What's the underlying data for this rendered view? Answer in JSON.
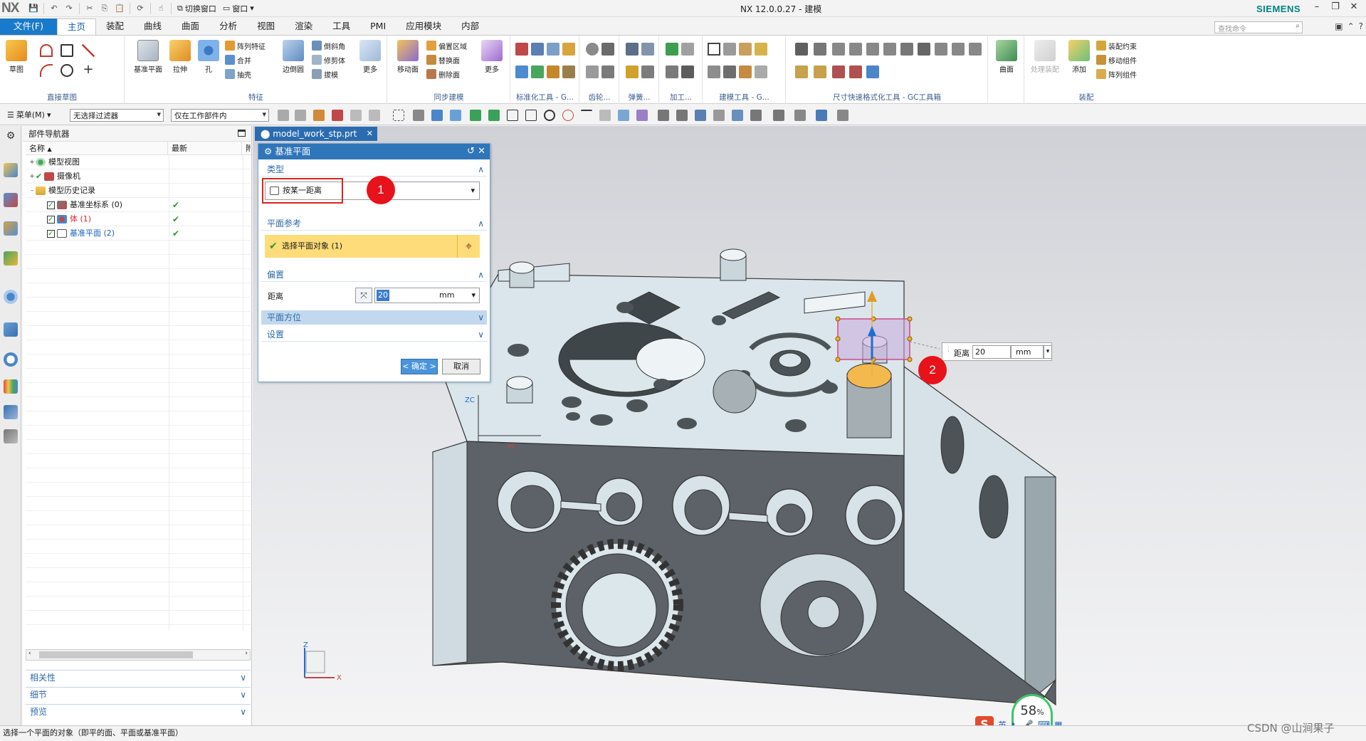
{
  "app": {
    "logo": "NX",
    "title": "NX 12.0.0.27 - 建模",
    "brand": "SIEMENS"
  },
  "quick_access": {
    "switch_window": "切换窗口",
    "window": "窗口"
  },
  "tabs": [
    {
      "label": "文件(F)"
    },
    {
      "label": "主页"
    },
    {
      "label": "装配"
    },
    {
      "label": "曲线"
    },
    {
      "label": "曲面"
    },
    {
      "label": "分析"
    },
    {
      "label": "视图"
    },
    {
      "label": "渲染"
    },
    {
      "label": "工具"
    },
    {
      "label": "PMI"
    },
    {
      "label": "应用模块"
    },
    {
      "label": "内部"
    }
  ],
  "command_search": {
    "placeholder": "查找命令"
  },
  "ribbon": {
    "groups": {
      "direct_sketch": "直接草图",
      "feature": "特征",
      "sync": "同步建模",
      "standard_tools": "标准化工具 - G...",
      "gear": "齿轮...",
      "spring": "弹簧...",
      "machining": "加工...",
      "modeling_tools": "建模工具 - G...",
      "dim_style": "尺寸快速格式化工具 - GC工具箱",
      "assembly": "装配"
    },
    "buttons": {
      "sketch": "草图",
      "datum_plane": "基准平面",
      "extrude": "拉伸",
      "hole": "孔",
      "pattern_feature": "阵列特征",
      "unite": "合并",
      "shell": "抽壳",
      "edge_blend": "边倒圆",
      "chamfer": "倒斜角",
      "trim_body": "修剪体",
      "draft": "拔模",
      "more": "更多",
      "move_face": "移动面",
      "offset_region": "偏置区域",
      "replace_face": "替换面",
      "delete_face": "删除面",
      "more2": "更多",
      "surface": "曲面",
      "process_assembly": "处理装配",
      "add": "添加",
      "assembly_constraints": "装配约束",
      "move_component": "移动组件",
      "pattern_component": "阵列组件"
    }
  },
  "selection_bar": {
    "menu": "菜单(M)",
    "filter": "无选择过滤器",
    "scope": "仅在工作部件内"
  },
  "navigator": {
    "title": "部件导航器",
    "columns": [
      "名称",
      "最新",
      "附"
    ],
    "rows": [
      {
        "label": "模型视图",
        "color": "#222222"
      },
      {
        "label": "摄像机",
        "color": "#222222"
      },
      {
        "label": "模型历史记录",
        "color": "#222222"
      },
      {
        "label": "基准坐标系 (0)",
        "color": "#222222"
      },
      {
        "label": "体 (1)",
        "color": "#e0242a"
      },
      {
        "label": "基准平面 (2)",
        "color": "#1d5fc2"
      }
    ],
    "panels": [
      "相关性",
      "细节",
      "预览"
    ]
  },
  "document_tab": {
    "label": "model_work_stp.prt"
  },
  "dialog": {
    "title": "基准平面",
    "type_section": "类型",
    "type_value": "按某一距离",
    "plane_ref_section": "平面参考",
    "select_object": "选择平面对象 (1)",
    "offset_section": "偏置",
    "distance_label": "距离",
    "distance_value": "20",
    "distance_unit": "mm",
    "orientation_section": "平面方位",
    "settings_section": "设置",
    "ok": "< 确定 >",
    "cancel": "取消"
  },
  "callouts": {
    "one": "1",
    "two": "2"
  },
  "float_distance": {
    "label": "距离",
    "value": "20",
    "unit": "mm"
  },
  "axes": {
    "zc": "ZC",
    "xc": "XC",
    "z": "Z",
    "x": "X"
  },
  "status_text": "选择一个平面的对象（即平的面、平面或基准平面）",
  "perf_meter": {
    "value": "58",
    "unit": "%"
  },
  "ime": {
    "lang": "英"
  },
  "watermark": "CSDN @山涧果子",
  "colors": {
    "accent": "#2f75b9",
    "selection_yellow": "#fddc79",
    "callout_red": "#e8121b",
    "model_top": "#dce7ec",
    "model_side": "#5d6367"
  }
}
